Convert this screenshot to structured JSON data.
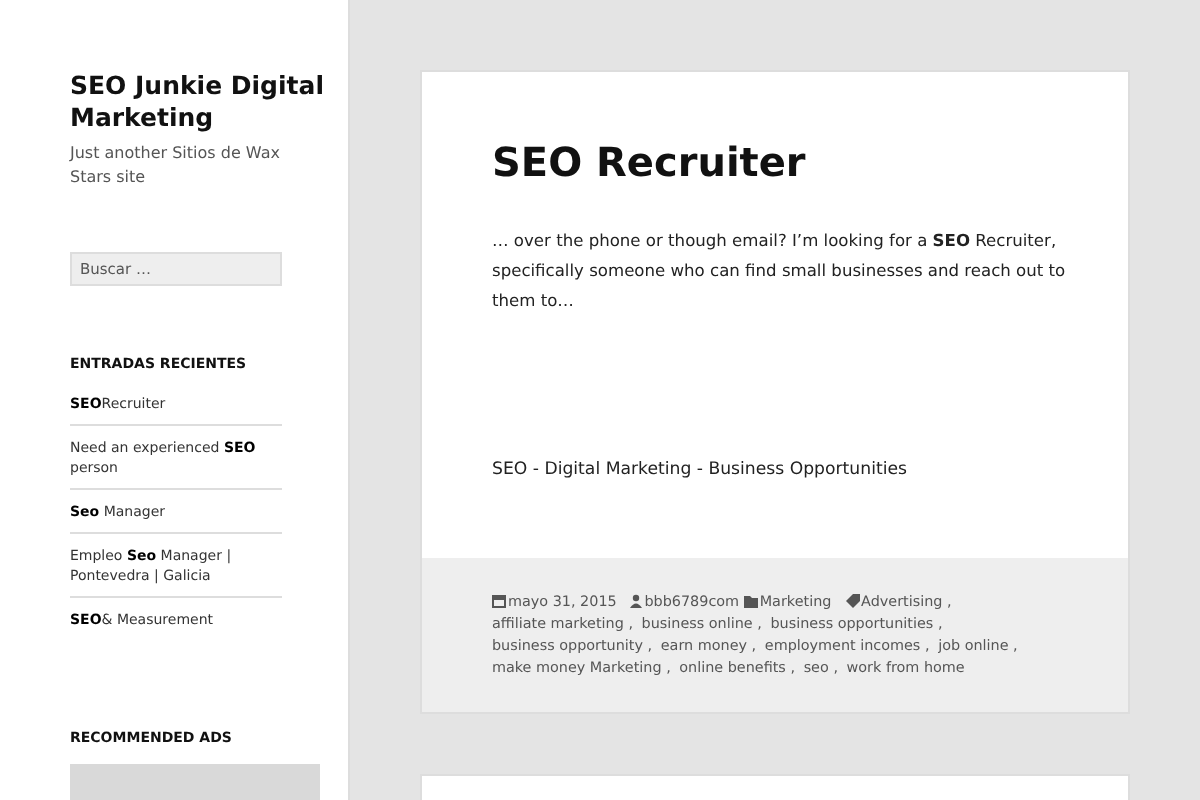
{
  "site": {
    "title": "SEO Junkie Digital Marketing",
    "tagline": "Just another Sitios de Wax Stars site"
  },
  "search": {
    "placeholder": "Buscar …"
  },
  "recent_posts": {
    "heading": "ENTRADAS RECIENTES",
    "items": [
      {
        "label": "**SEO**Recruiter"
      },
      {
        "label": "Need an experienced **SEO** person"
      },
      {
        "label": "**Seo** Manager"
      },
      {
        "label": "Empleo **Seo** Manager | Pontevedra | Galicia"
      },
      {
        "label": "**SEO**& Measurement"
      }
    ]
  },
  "ads": {
    "heading": "RECOMMENDED ADS"
  },
  "post": {
    "title": "SEO Recruiter",
    "excerpt": "… over the phone or though email? I’m looking for a **SEO** Recruiter, specifically someone who can find small businesses and reach out to them to…",
    "links": "SEO - Digital Marketing - Business Opportunities",
    "meta": {
      "separator": ",",
      "date": "mayo 31, 2015",
      "author": "bbb6789com",
      "category": "Marketing",
      "tags": [
        "Advertising",
        "affiliate marketing",
        "business online",
        "business opportunities",
        "business opportunity",
        "earn money",
        "employment incomes",
        "job online",
        "make money Marketing",
        "online benefits",
        "seo",
        "work from home"
      ]
    }
  }
}
